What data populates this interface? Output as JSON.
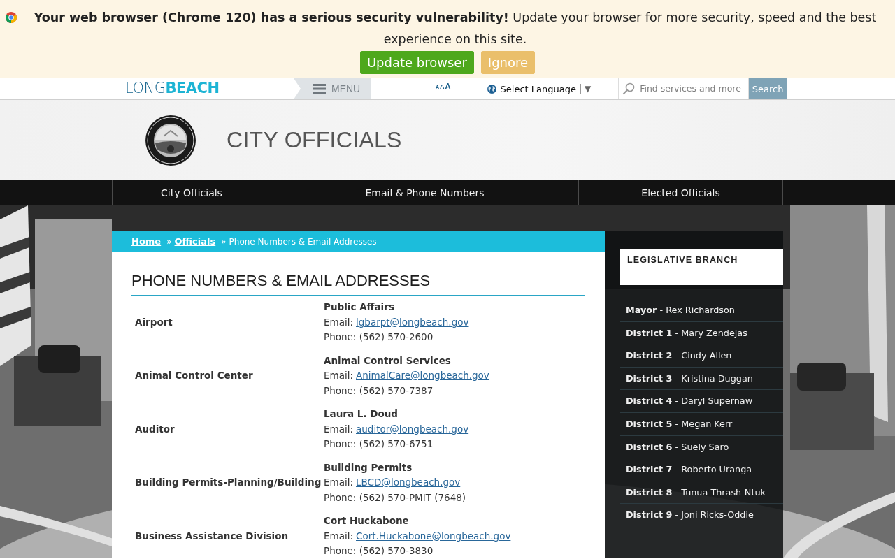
{
  "browser_banner": {
    "message": "**Your web browser (Chrome 120) has a serious security vulnerability!** Update your browser for more security, speed and the best experience on this site.",
    "buttons": [
      {
        "label": "Update browser",
        "kind": "primary"
      },
      {
        "label": "Ignore",
        "kind": "secondary"
      }
    ]
  },
  "top_bar": {
    "logo": {
      "part_1": "LONG",
      "part_2": "BEACH"
    },
    "menu": "MENU",
    "text_size": [
      "A",
      "A",
      "A"
    ],
    "language": {
      "label": "Select Language",
      "caret": "▼"
    },
    "search": {
      "placeholder": "Find services and more",
      "button": "Search"
    }
  },
  "header": {
    "title": "CITY OFFICIALS"
  },
  "nav": [
    "City Officials",
    "Email & Phone Numbers",
    "Elected Officials"
  ],
  "breadcrumb": [
    {
      "label": "Home",
      "kind": "link"
    },
    {
      "label": "»",
      "kind": "separator"
    },
    {
      "label": "Officials",
      "kind": "link"
    },
    {
      "label": "»",
      "kind": "separator"
    },
    {
      "label": "Phone Numbers & Email Addresses",
      "kind": "current"
    }
  ],
  "content": {
    "title": "PHONE NUMBERS & EMAIL ADDRESSES",
    "rows": [
      {
        "department": "Airport",
        "contact": "Public Affairs",
        "email_label": "Email:",
        "email": "lgbarpt@longbeach.gov",
        "phone": "Phone: (562) 570-2600"
      },
      {
        "department": "Animal Control Center",
        "contact": "Animal Control Services",
        "email_label": "Email:",
        "email": "AnimalCare@longbeach.gov",
        "phone": "Phone: (562) 570-7387"
      },
      {
        "department": "Auditor",
        "contact": "Laura L. Doud",
        "email_label": "Email:",
        "email": "auditor@longbeach.gov",
        "phone": "Phone: (562) 570-6751"
      },
      {
        "department": "Building Permits-Planning/Building",
        "contact": "Building Permits",
        "email_label": "Email:",
        "email": "LBCD@longbeach.gov",
        "phone": "Phone: (562) 570-PMIT (7648)"
      },
      {
        "department": "Business Assistance Division",
        "contact": "Cort Huckabone",
        "email_label": "Email:",
        "email": "Cort.Huckabone@longbeach.gov",
        "phone": "Phone: (562) 570-3830"
      }
    ]
  },
  "sidebar": {
    "heading": "LEGISLATIVE BRANCH",
    "items": [
      "**Mayor** - Rex Richardson",
      "**District 1** - Mary Zendejas",
      "**District 2** - Cindy Allen",
      "**District 3** - Kristina Duggan",
      "**District 4** - Daryl Supernaw",
      "**District 5** - Megan Kerr",
      "**District 6** - Suely Saro",
      "**District 7** - Roberto Uranga",
      "**District 8** - Tunua Thrash-Ntuk",
      "**District 9** - Joni Ricks-Oddie"
    ]
  }
}
